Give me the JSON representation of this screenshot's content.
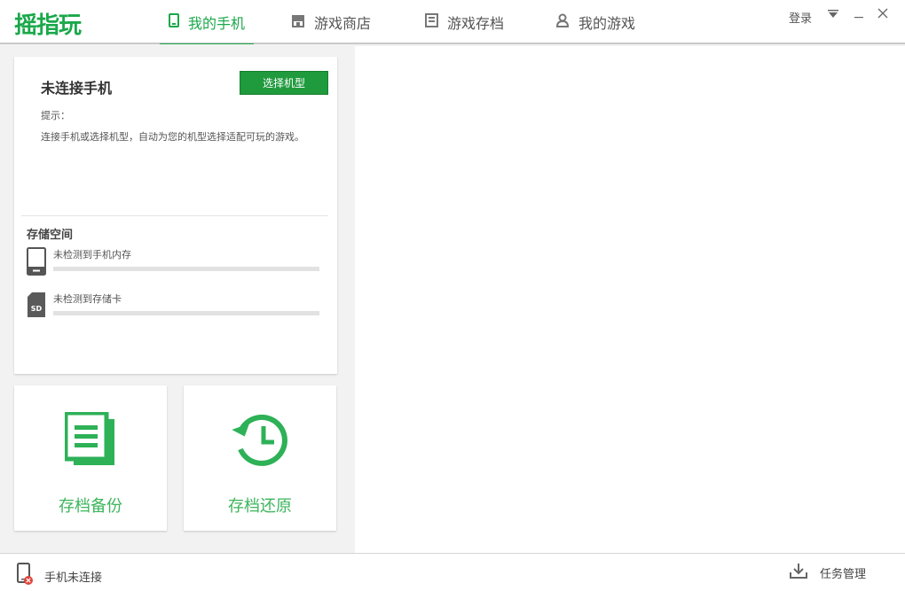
{
  "app": {
    "logo": "摇指玩"
  },
  "nav": {
    "tabs": [
      {
        "label": "我的手机",
        "icon": "phone-icon",
        "active": true
      },
      {
        "label": "游戏商店",
        "icon": "store-icon",
        "active": false
      },
      {
        "label": "游戏存档",
        "icon": "archive-icon",
        "active": false
      },
      {
        "label": "我的游戏",
        "icon": "user-icon",
        "active": false
      }
    ]
  },
  "window": {
    "login": "登录",
    "menu_icon": "dropdown-icon",
    "minimize": "—",
    "close": "✕"
  },
  "connection": {
    "title": "未连接手机",
    "select_button": "选择机型",
    "hint_label": "提示：",
    "hint_text": "连接手机或选择机型，自动为您的机型选择适配可玩的游戏。"
  },
  "storage": {
    "title": "存储空间",
    "phone_label": "未检测到手机内存",
    "sd_label": "未检测到存储卡",
    "sd_badge": "SD"
  },
  "actions": {
    "backup_label": "存档备份",
    "restore_label": "存档还原"
  },
  "status": {
    "phone_status": "手机未连接",
    "task_manager": "任务管理"
  },
  "colors": {
    "accent": "#1aa84a",
    "button": "#1f9a3c",
    "action_text": "#3cb55c"
  }
}
